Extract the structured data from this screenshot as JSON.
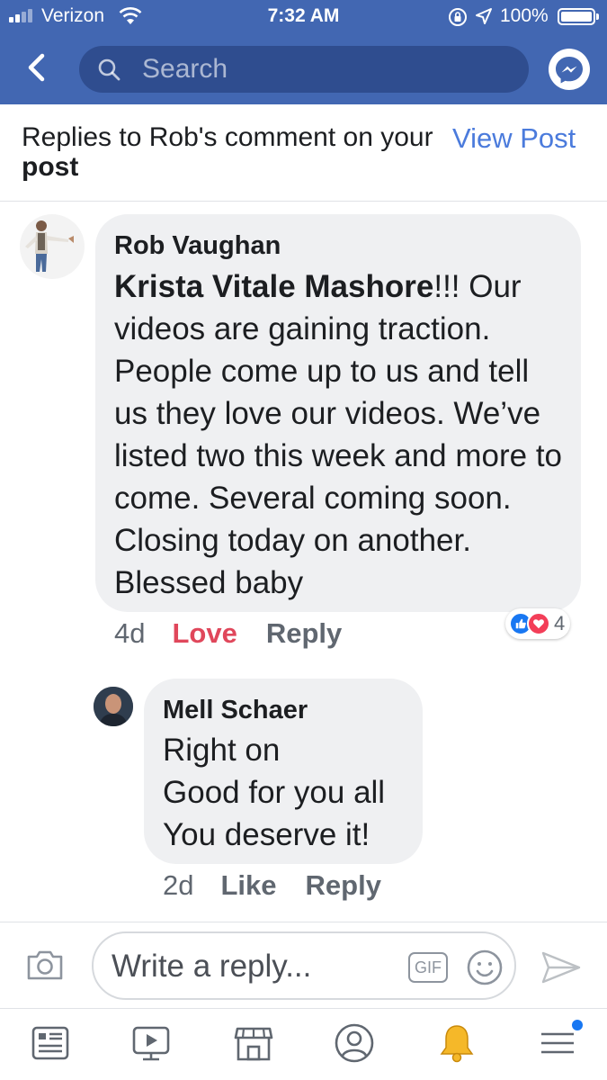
{
  "status_bar": {
    "carrier": "Verizon",
    "time": "7:32 AM",
    "battery": "100%"
  },
  "nav": {
    "search_placeholder": "Search"
  },
  "header": {
    "title_prefix": "Replies to Rob's comment on your",
    "title_bold": "post",
    "view_post": "View Post"
  },
  "comments": [
    {
      "author": "Rob Vaughan",
      "mention": "Krista Vitale Mashore",
      "text": "!!! Our videos are gaining traction. People come up to us and tell us they love our videos. We’ve listed two this week and more to come. Several coming soon. Closing today on another. Blessed baby",
      "time": "4d",
      "reaction_action": "Love",
      "reply_label": "Reply",
      "reaction_icons": [
        "like-icon",
        "heart-icon"
      ],
      "reaction_count": "4"
    },
    {
      "author": "Mell Schaer",
      "lines": [
        "Right on",
        "Good for you all",
        "You deserve it!"
      ],
      "time": "2d",
      "reaction_action": "Like",
      "reply_label": "Reply"
    }
  ],
  "composer": {
    "placeholder": "Write a reply...",
    "gif_label": "GIF"
  },
  "tab_bar": {
    "items": [
      "news-feed-icon",
      "watch-icon",
      "marketplace-icon",
      "profile-icon",
      "notifications-icon",
      "menu-icon"
    ]
  },
  "colors": {
    "brand_blue": "#4267b2",
    "search_fill": "#2f4d8f",
    "link_blue": "#4b7bdc",
    "love_red": "#e0475b",
    "bubble_gray": "#eff0f2"
  }
}
